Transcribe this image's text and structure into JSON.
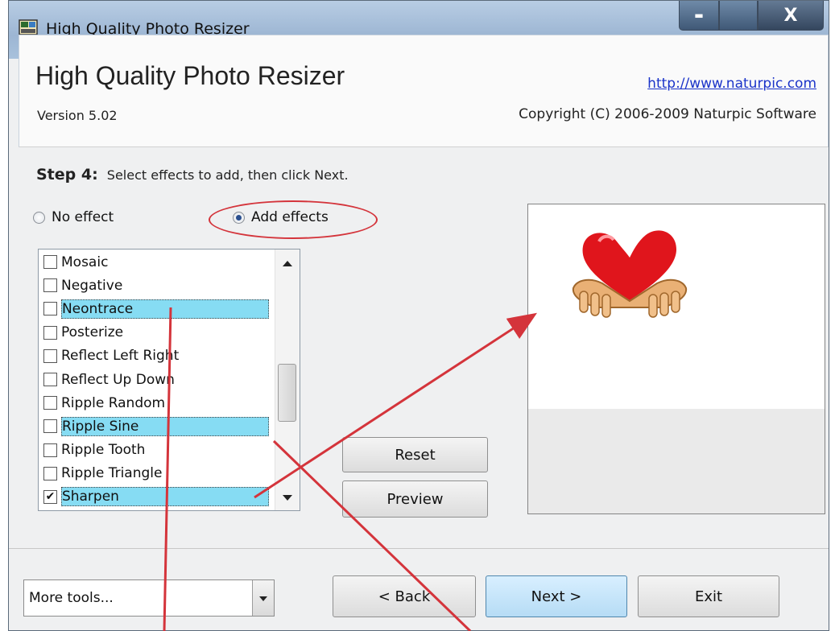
{
  "window": {
    "title": "High Quality Photo Resizer",
    "min_glyph": "▬",
    "close_glyph": "X"
  },
  "header": {
    "app_title": "High Quality Photo Resizer",
    "version": "Version 5.02",
    "url": "http://www.naturpic.com",
    "copyright": "Copyright (C) 2006-2009 Naturpic Software"
  },
  "step": {
    "label": "Step 4:",
    "instruction": "Select effects to add, then click Next."
  },
  "radios": {
    "no_effect": "No effect",
    "add_effects": "Add effects",
    "selected": "add_effects"
  },
  "effects": [
    {
      "label": "Mosaic",
      "checked": false,
      "highlighted": false
    },
    {
      "label": "Negative",
      "checked": false,
      "highlighted": false
    },
    {
      "label": "Neontrace",
      "checked": false,
      "highlighted": true
    },
    {
      "label": "Posterize",
      "checked": false,
      "highlighted": false
    },
    {
      "label": "Reflect Left Right",
      "checked": false,
      "highlighted": false
    },
    {
      "label": "Reflect Up Down",
      "checked": false,
      "highlighted": false
    },
    {
      "label": "Ripple Random",
      "checked": false,
      "highlighted": false
    },
    {
      "label": "Ripple Sine",
      "checked": false,
      "highlighted": true
    },
    {
      "label": "Ripple Tooth",
      "checked": false,
      "highlighted": false
    },
    {
      "label": "Ripple Triangle",
      "checked": false,
      "highlighted": false
    },
    {
      "label": "Sharpen",
      "checked": true,
      "highlighted": true
    }
  ],
  "buttons": {
    "reset": "Reset",
    "preview": "Preview",
    "back": "< Back",
    "next": "Next >",
    "exit": "Exit"
  },
  "tools_combo": {
    "value": "More tools..."
  },
  "colors": {
    "highlight": "#86dcf3",
    "annotation": "#d4343b",
    "link": "#1a33c9"
  }
}
